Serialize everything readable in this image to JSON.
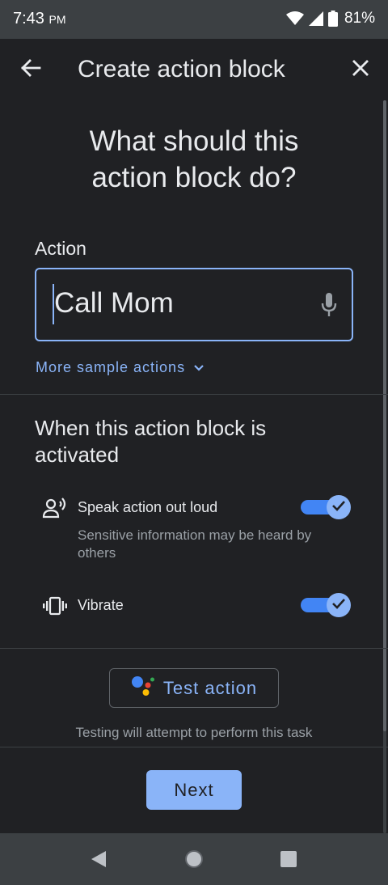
{
  "status_bar": {
    "time": "7:43",
    "ampm": "PM",
    "battery": "81%",
    "icons": [
      "wifi-icon",
      "signal-icon",
      "battery-icon"
    ]
  },
  "app_bar": {
    "title": "Create action block",
    "back_icon": "arrow-left-icon",
    "close_icon": "close-icon"
  },
  "headline": {
    "line1": "What should this",
    "line2": "action block do?"
  },
  "action_field": {
    "label": "Action",
    "value": "Call Mom",
    "icon": "microphone-icon"
  },
  "more_samples": {
    "label": "More sample actions",
    "icon": "chevron-down-icon"
  },
  "activation": {
    "title": "When this action block is activated",
    "options": [
      {
        "label": "Speak action out loud",
        "description": "Sensitive information may be heard by others",
        "icon": "speaker-person-icon",
        "enabled": true
      },
      {
        "label": "Vibrate",
        "icon": "vibrate-icon",
        "enabled": true
      }
    ]
  },
  "test": {
    "button_label": "Test action",
    "hint": "Testing will attempt to perform this task",
    "icon": "assistant-icon"
  },
  "footer": {
    "next_label": "Next"
  },
  "colors": {
    "accent": "#8ab4f8",
    "toggle_track": "#4285f4",
    "background": "#202124",
    "surface": "#3c4043"
  }
}
